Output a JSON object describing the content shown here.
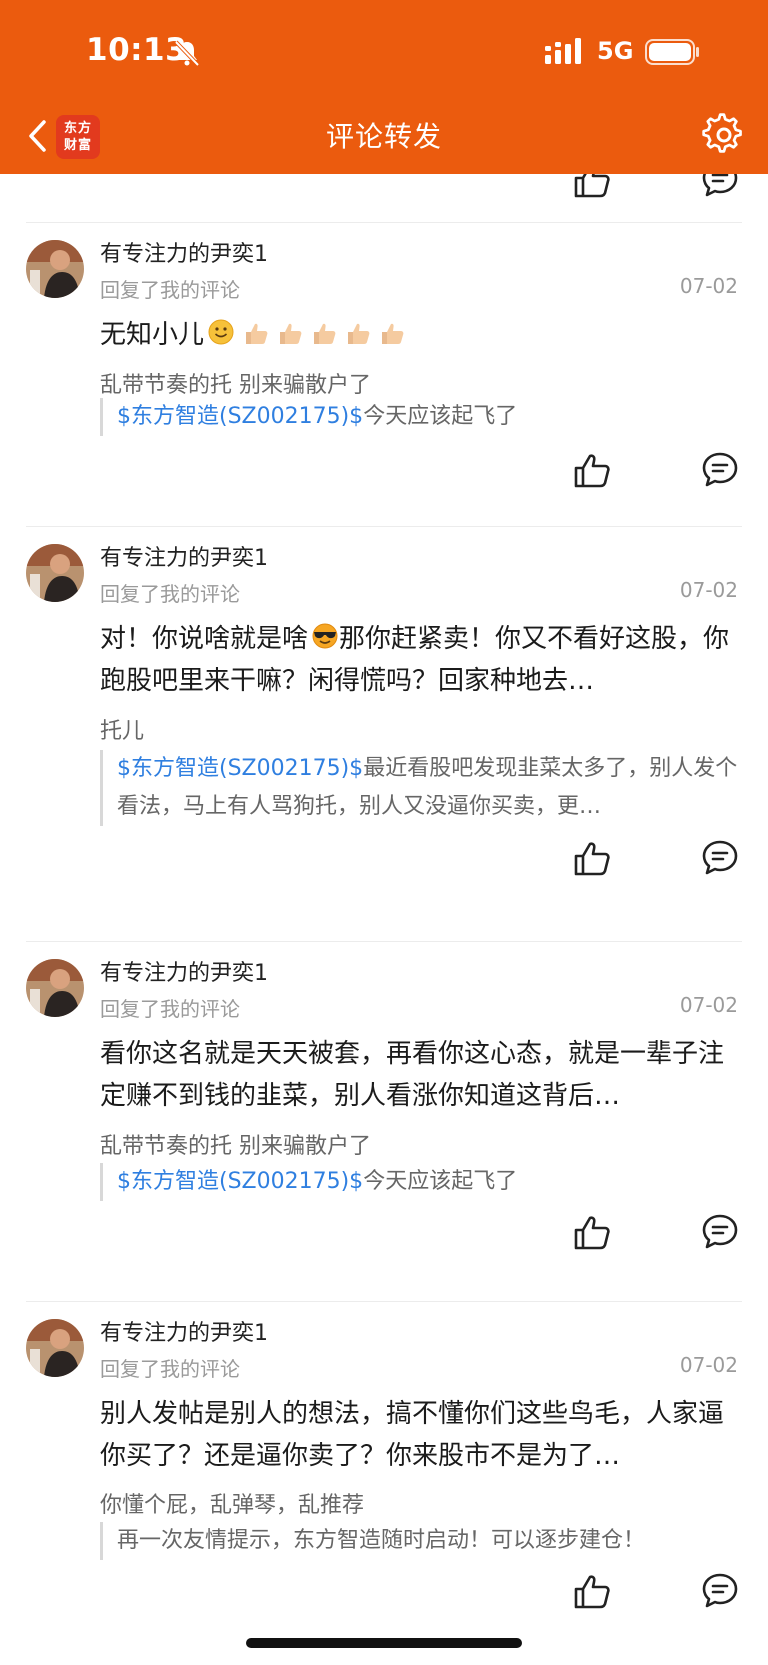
{
  "status_bar": {
    "time": "10:13",
    "network": "5G"
  },
  "nav": {
    "title": "评论转发",
    "logo_line1": "东方",
    "logo_line2": "财富"
  },
  "items": [
    {
      "user": "有专注力的尹奕1",
      "subtitle": "回复了我的评论",
      "date": "07-02",
      "reply": "无知小儿",
      "reply_emojis": [
        "smiling-face",
        "thumbs-up",
        "thumbs-up",
        "thumbs-up",
        "thumbs-up",
        "thumbs-up"
      ],
      "comment": "乱带节奏的托 别来骗散户了",
      "quote_stock": "$东方智造(SZ002175)$",
      "quote_text": "今天应该起飞了"
    },
    {
      "user": "有专注力的尹奕1",
      "subtitle": "回复了我的评论",
      "date": "07-02",
      "reply_pre": "对！你说啥就是啥",
      "reply_emoji": "cool-face",
      "reply_post": "那你赶紧卖！你又不看好这股，你跑股吧里来干嘛？闲得慌吗？回家种地去…",
      "comment": "托儿",
      "quote_stock": "$东方智造(SZ002175)$",
      "quote_text": "最近看股吧发现韭菜太多了，别人发个看法，马上有人骂狗托，别人又没逼你买卖，更…"
    },
    {
      "user": "有专注力的尹奕1",
      "subtitle": "回复了我的评论",
      "date": "07-02",
      "reply": "看你这名就是天天被套，再看你这心态，就是一辈子注定赚不到钱的韭菜，别人看涨你知道这背后…",
      "comment": "乱带节奏的托 别来骗散户了",
      "quote_stock": "$东方智造(SZ002175)$",
      "quote_text": "今天应该起飞了"
    },
    {
      "user": "有专注力的尹奕1",
      "subtitle": "回复了我的评论",
      "date": "07-02",
      "reply": "别人发帖是别人的想法，搞不懂你们这些鸟毛，人家逼你买了？还是逼你卖了？你来股市不是为了…",
      "comment": "你懂个屁，乱弹琴，乱推荐",
      "quote_text": "再一次友情提示，东方智造随时启动！可以逐步建仓！"
    }
  ],
  "colors": {
    "brand": "#EB5B0E",
    "link": "#2F7FE0",
    "logo": "#E23A1E"
  },
  "icons": [
    "chevron-left-icon",
    "settings-icon",
    "like-icon",
    "comment-icon",
    "avatar"
  ]
}
